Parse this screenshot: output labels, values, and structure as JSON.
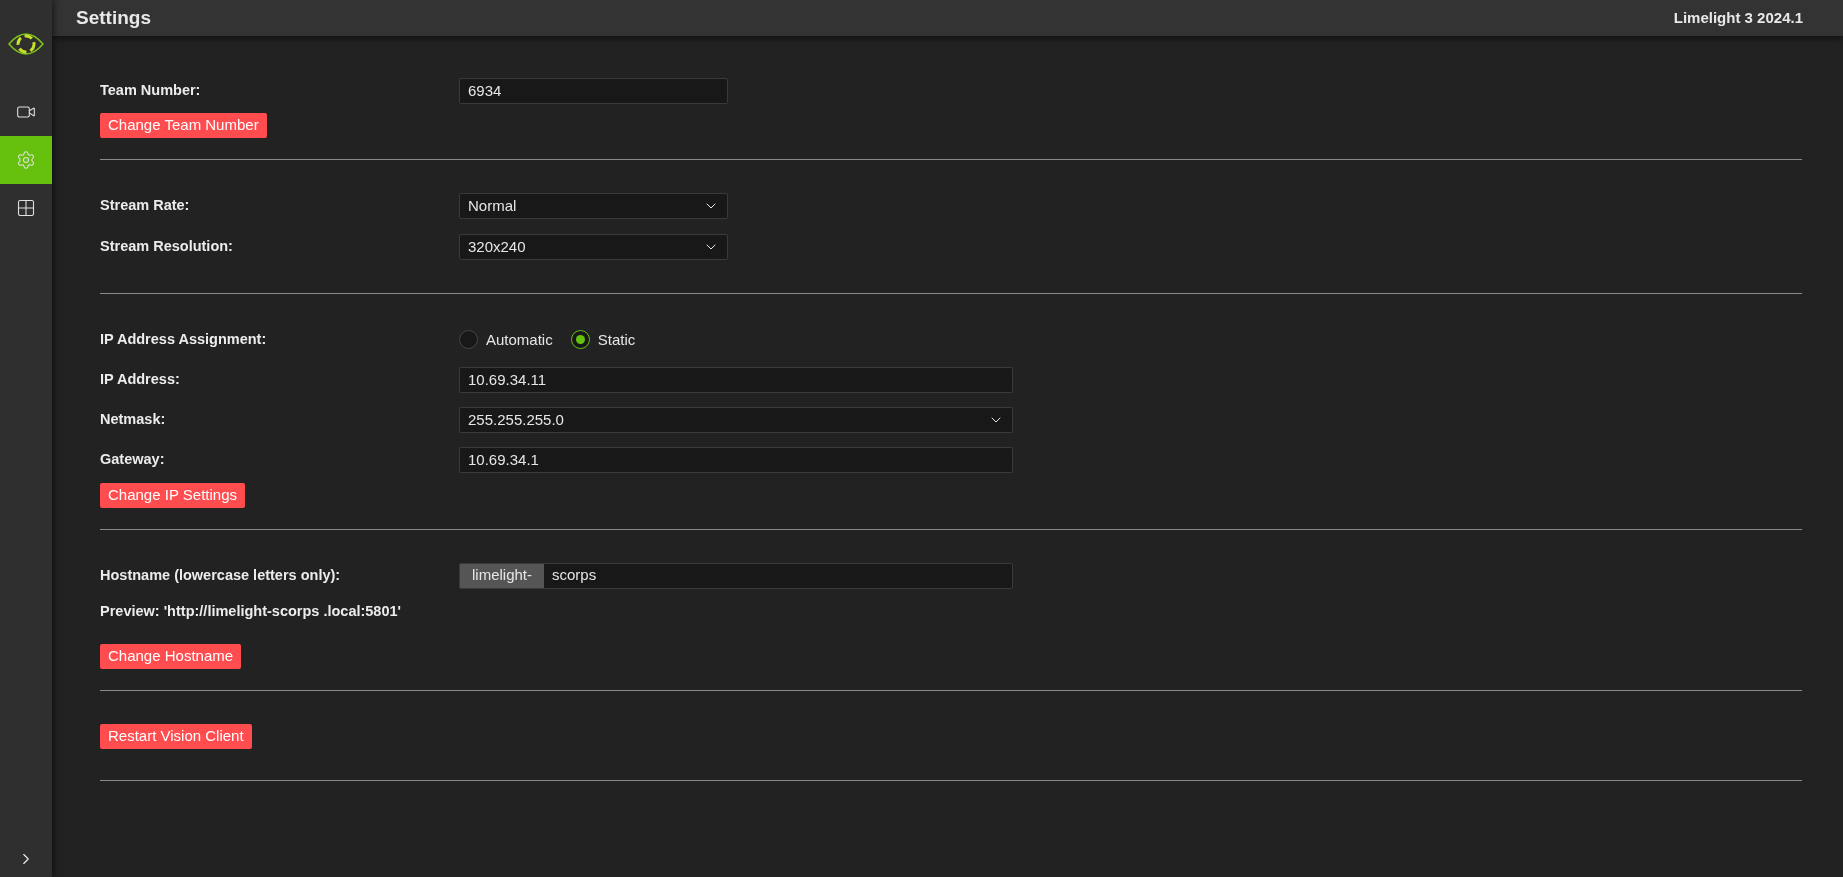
{
  "header": {
    "title": "Settings",
    "version": "Limelight 3 2024.1"
  },
  "sidebar": {
    "items": [
      {
        "kind": "camera",
        "selected": false
      },
      {
        "kind": "settings",
        "selected": true
      },
      {
        "kind": "grid",
        "selected": false
      }
    ]
  },
  "team": {
    "label": "Team Number:",
    "value": "6934",
    "button": "Change Team Number"
  },
  "stream": {
    "rows": [
      {
        "label": "Stream Rate:",
        "value": "Normal"
      },
      {
        "label": "Stream Resolution:",
        "value": "320x240"
      }
    ]
  },
  "network": {
    "assignment_label": "IP Address Assignment:",
    "options": [
      {
        "label": "Automatic",
        "selected": false
      },
      {
        "label": "Static",
        "selected": true
      }
    ],
    "rows": [
      {
        "kind": "input",
        "label": "IP Address:",
        "value": "10.69.34.11"
      },
      {
        "kind": "select",
        "label": "Netmask:",
        "value": "255.255.255.0"
      },
      {
        "kind": "input",
        "label": "Gateway:",
        "value": "10.69.34.1"
      }
    ],
    "button": "Change IP Settings"
  },
  "hostname": {
    "label": "Hostname (lowercase letters only):",
    "prefix": "limelight-",
    "value": "scorps",
    "preview": "Preview: 'http://limelight-scorps .local:5801'",
    "button": "Change Hostname"
  },
  "restart": {
    "button": "Restart Vision Client"
  }
}
